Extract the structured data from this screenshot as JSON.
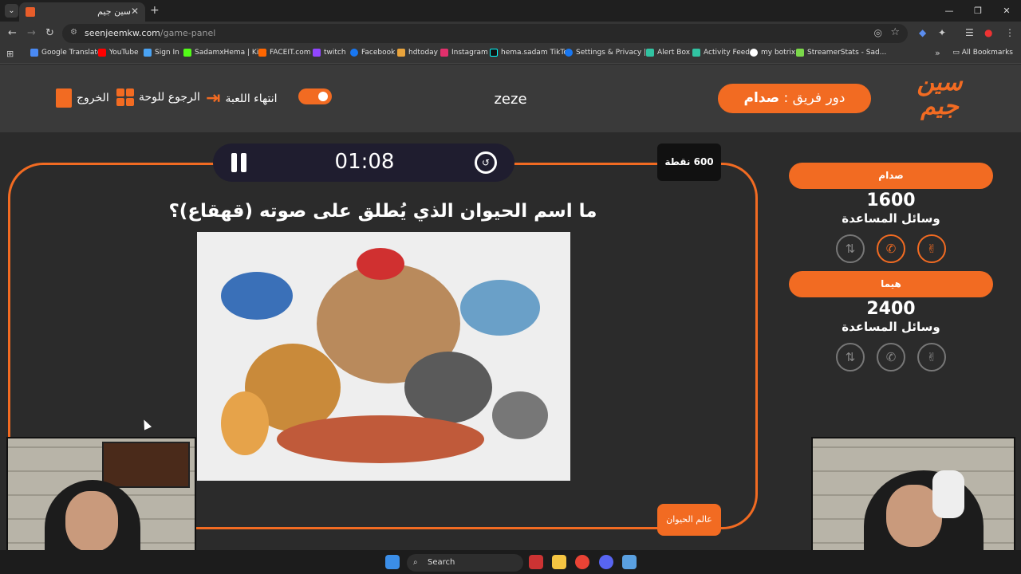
{
  "browser": {
    "tab_title": "سين جيم",
    "url_host": "seenjeemkw.com",
    "url_path": "/game-panel",
    "bookmarks": [
      "Google Translate",
      "YouTube",
      "Sign In",
      "SadamxHema | Kick",
      "FACEIT.com",
      "twitch",
      "Facebook",
      "hdtoday",
      "Instagram",
      "hema.sadam TikTok",
      "Settings & Privacy |...",
      "Alert Box",
      "Activity Feed",
      "my botrix",
      "StreamerStats - Sad..."
    ],
    "all_bookmarks": "All Bookmarks"
  },
  "header": {
    "logo_text": "سين جيم",
    "turn_prefix": "دور فريق : ",
    "turn_team": "صدام",
    "game_name": "zeze",
    "end_game": "انتهاء اللعبة",
    "back_to_board": "الرجوع للوحة",
    "exit": "الخروج"
  },
  "timer": {
    "value": "01:08"
  },
  "question": {
    "points": "600 نقطة",
    "text": "ما اسم الحيوان الذي يُطلق على صوته (قهقاع)؟",
    "category": "عالم الحيوان"
  },
  "teams": [
    {
      "name": "صدام",
      "score": "1600",
      "help_label": "وسائل المساعدة"
    },
    {
      "name": "هيما",
      "score": "2400",
      "help_label": "وسائل المساعدة"
    }
  ],
  "taskbar": {
    "search_placeholder": "Search"
  },
  "colors": {
    "accent": "#f26b22",
    "background": "#2b2b2b",
    "header": "#3a3a3a"
  }
}
